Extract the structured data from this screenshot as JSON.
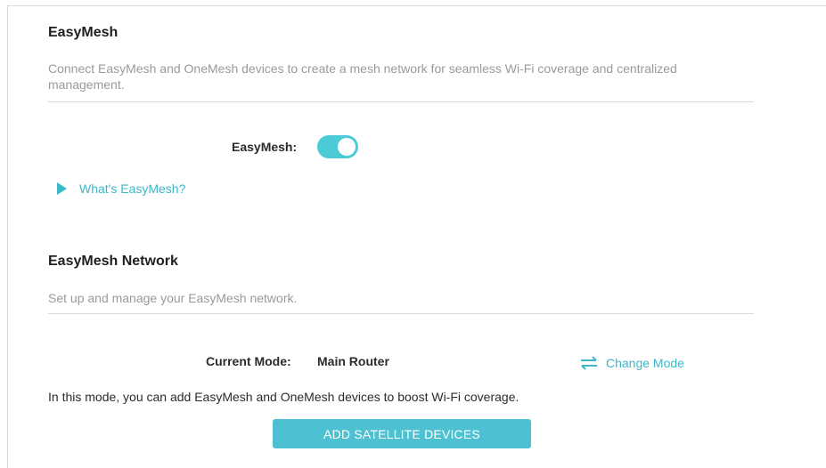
{
  "easymesh_section": {
    "title": "EasyMesh",
    "description": "Connect EasyMesh and OneMesh devices to create a mesh network for seamless Wi-Fi coverage and centralized management.",
    "toggle_label": "EasyMesh:",
    "toggle_state": "on",
    "help_link": "What's EasyMesh?"
  },
  "network_section": {
    "title": "EasyMesh Network",
    "description": "Set up and manage your EasyMesh network.",
    "current_mode_label": "Current Mode:",
    "current_mode_value": "Main Router",
    "change_mode_label": "Change Mode",
    "info_text": "In this mode, you can add EasyMesh and OneMesh devices to boost Wi-Fi coverage.",
    "add_button_label": "ADD SATELLITE DEVICES"
  },
  "colors": {
    "accent": "#4acbd6",
    "link": "#3bb7c8",
    "button": "#4dc1d1"
  },
  "icons": {
    "expander": "triangle-right-icon",
    "change_mode": "swap-arrows-icon"
  }
}
